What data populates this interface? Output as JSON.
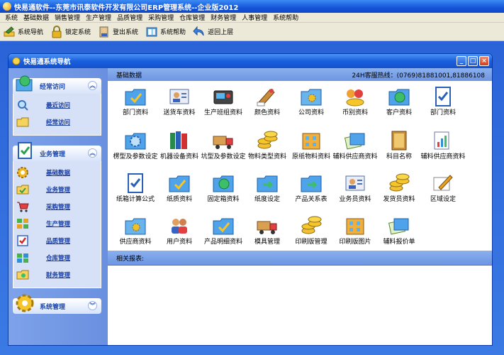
{
  "app_title": "快易通软件--东莞市讯泰软件开发有限公司ERP管理系统--企业版2012",
  "menu": [
    "系统",
    "基础数据",
    "销售管理",
    "生产管理",
    "品质管理",
    "采购管理",
    "仓库管理",
    "财务管理",
    "人事管理",
    "系统帮助"
  ],
  "toolbar": {
    "nav": "系统导航",
    "lock": "锁定系统",
    "logout": "登出系统",
    "help": "系统帮助",
    "back": "返回上层"
  },
  "window": {
    "title": "快易通系统导航"
  },
  "sidebar": {
    "sections": [
      {
        "title": "经常访问",
        "items": [
          "最近访问",
          "经常访问"
        ]
      },
      {
        "title": "业务管理",
        "items": [
          "基础数据",
          "业务管理",
          "采购管理",
          "生产管理",
          "品质管理",
          "仓库管理",
          "财务管理"
        ]
      },
      {
        "title": "系统管理"
      }
    ]
  },
  "content": {
    "heading": "基础数据",
    "hotline": "24H客服热线：(0769)81881001,81886108",
    "related": "相关报表:",
    "items": [
      "部门资料",
      "送货车资料",
      "生产班组资料",
      "颜色资料",
      "公司资料",
      "币别资料",
      "客户资料",
      "部门资料",
      "楞型及参数设定",
      "机器设备资料",
      "坑型及参数设定",
      "物料类型资料",
      "原纸物料资料",
      "辅料供应商资料",
      "科目名称",
      "辅料供应商资料",
      "纸箱计算公式",
      "纸质资料",
      "固定箱资料",
      "纸度设定",
      "产品关系表",
      "业务员资料",
      "发货员资料",
      "区域设定",
      "供应商资料",
      "用户资料",
      "产品明细资料",
      "模具管理",
      "印刷版管理",
      "印刷版图片",
      "辅料报价单"
    ],
    "item_icons": [
      "folder-check-icon",
      "person-card-icon",
      "scanner-icon",
      "paint-palette-icon",
      "folder-gear-icon",
      "coins-people-icon",
      "globe-folder-icon",
      "checklist-icon",
      "gear-folder-icon",
      "books-icon",
      "truck-icon",
      "coin-stack-icon",
      "building-icon",
      "cards-icon",
      "book-icon",
      "chart-person-icon",
      "checklist-icon",
      "folder-check-icon",
      "globe-folder-icon",
      "folder-arrow-icon",
      "folder-arrow-icon",
      "person-card-icon",
      "coin-stack-icon",
      "pen-paper-icon",
      "folder-gear-icon",
      "people-icon",
      "folder-check-icon",
      "truck-icon",
      "coin-stack-icon",
      "building-icon",
      "cards-icon"
    ]
  }
}
